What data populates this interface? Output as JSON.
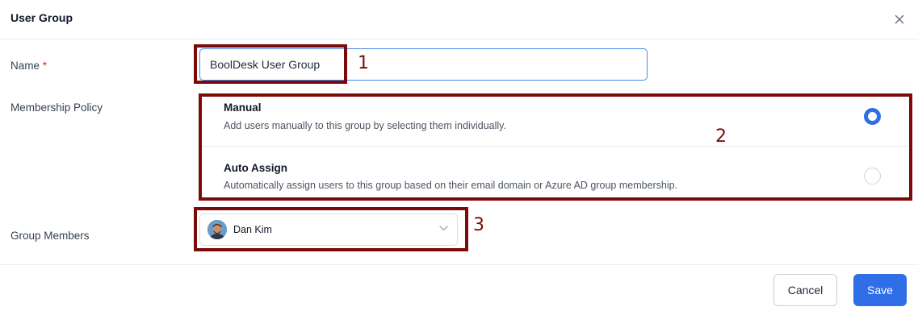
{
  "dialog": {
    "title": "User Group"
  },
  "form": {
    "name_label": "Name",
    "required_marker": "*",
    "name_value": "BoolDesk User Group",
    "membership_label": "Membership Policy",
    "policy_options": [
      {
        "title": "Manual",
        "description": "Add users manually to this group by selecting them individually.",
        "selected": true
      },
      {
        "title": "Auto Assign",
        "description": "Automatically assign users to this group based on their email domain or Azure AD group membership.",
        "selected": false
      }
    ],
    "members_label": "Group Members",
    "selected_member": "Dan Kim"
  },
  "footer": {
    "cancel_label": "Cancel",
    "save_label": "Save"
  },
  "annotations": [
    "1",
    "2",
    "3"
  ],
  "colors": {
    "accent": "#2f6ee6",
    "annotation": "#7b0b0b",
    "required": "#dc2626"
  },
  "icons": {
    "close": "close-icon",
    "select_arrow": "chevron-down-icon",
    "radio_selected": "radio-checked-icon",
    "radio_unselected": "radio-unchecked-icon"
  }
}
